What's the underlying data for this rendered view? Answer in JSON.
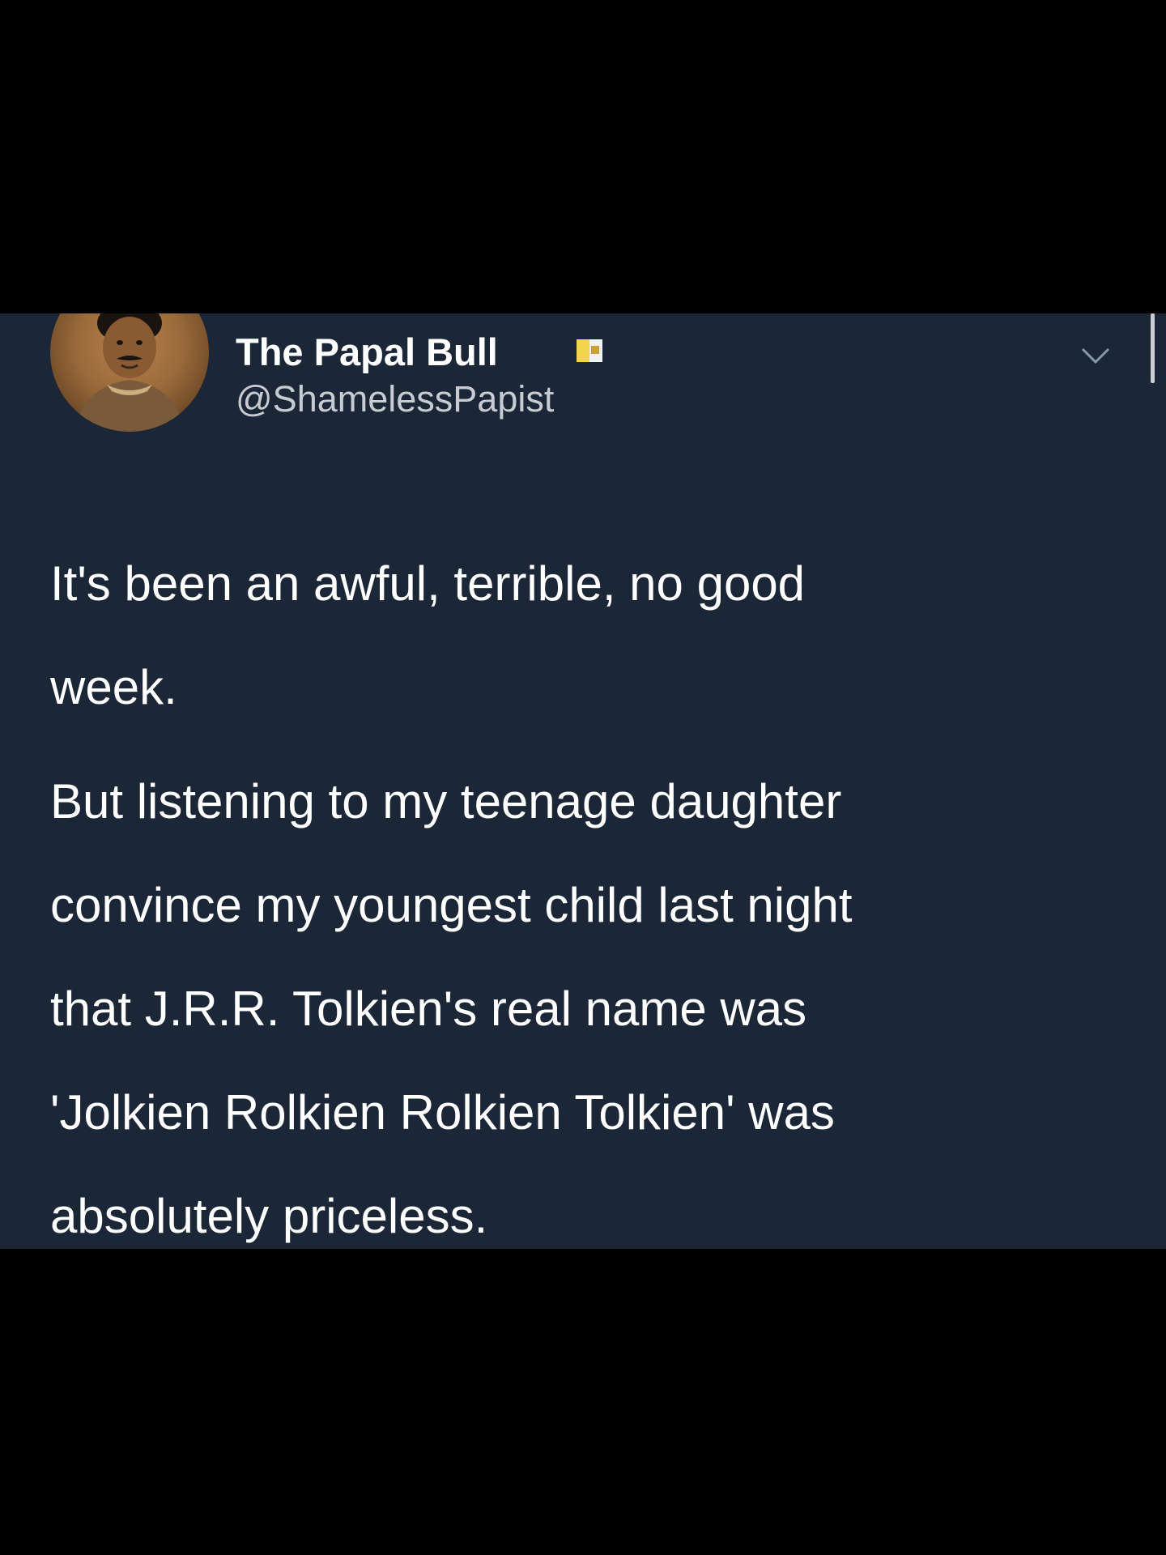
{
  "tweet": {
    "display_name": "The Papal Bull",
    "handle": "@ShamelessPapist",
    "paragraphs": [
      "It's been an awful, terrible, no good\nweek.",
      "But listening to my teenage daughter\nconvince my youngest child last night\nthat J.R.R. Tolkien's real name was\n'Jolkien Rolkien Rolkien Tolkien' was\nabsolutely priceless."
    ]
  },
  "icons": {
    "badge": "papal-flag-icon",
    "menu": "chevron-down-icon"
  },
  "colors": {
    "card_background": "#1b2637",
    "page_background": "#000000",
    "text": "#ffffff",
    "handle_text": "#c7ccd3",
    "badge_yellow": "#f4d44a"
  }
}
